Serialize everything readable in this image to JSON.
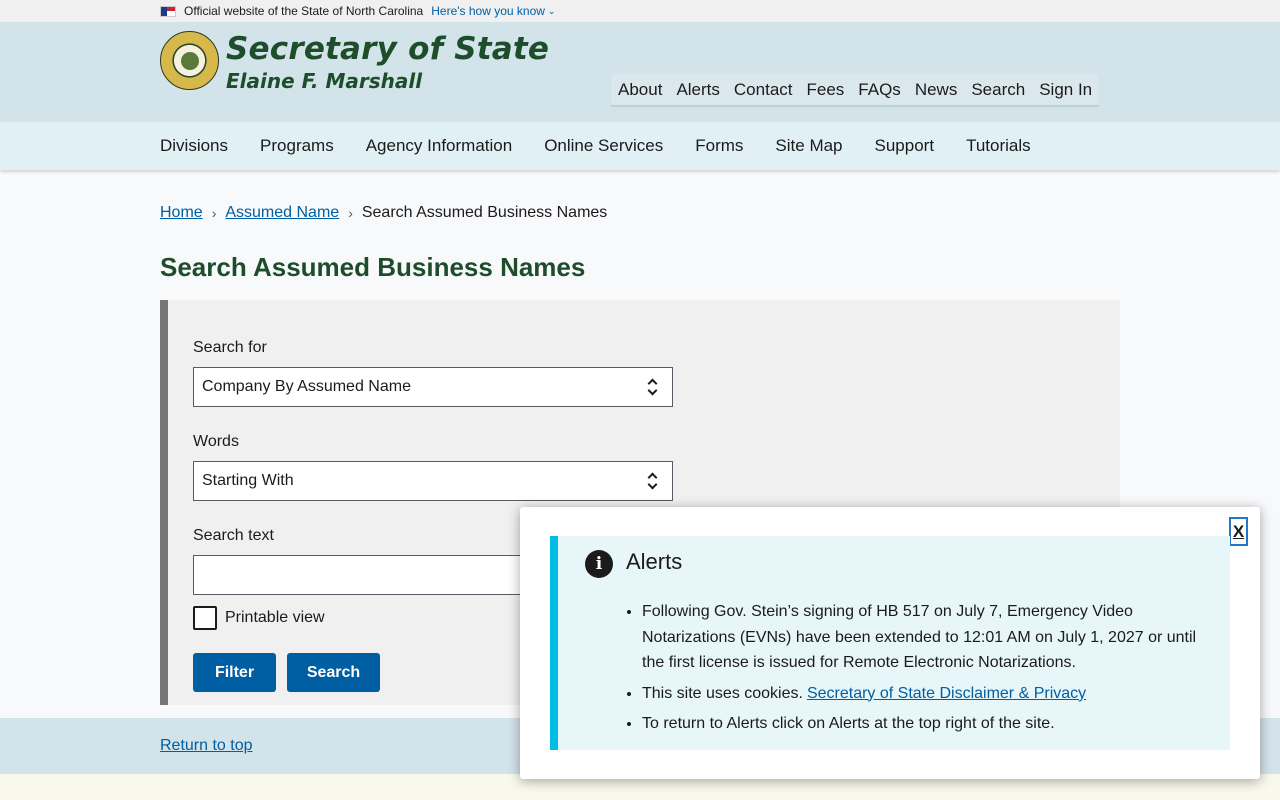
{
  "gov_banner": {
    "text": "Official website of the State of North Carolina",
    "link": "Here's how you know"
  },
  "header": {
    "title": "Secretary of State",
    "subtitle": "Elaine F. Marshall",
    "utility_nav": [
      "About",
      "Alerts",
      "Contact",
      "Fees",
      "FAQs",
      "News",
      "Search",
      "Sign In"
    ]
  },
  "main_nav": [
    "Divisions",
    "Programs",
    "Agency Information",
    "Online Services",
    "Forms",
    "Site Map",
    "Support",
    "Tutorials"
  ],
  "breadcrumb": {
    "home": "Home",
    "parent": "Assumed Name",
    "current": "Search Assumed Business Names"
  },
  "page_title": "Search Assumed Business Names",
  "form": {
    "search_for_label": "Search for",
    "search_for_value": "Company By Assumed Name",
    "words_label": "Words",
    "words_value": "Starting With",
    "search_text_label": "Search text",
    "search_text_value": "",
    "printable_label": "Printable view",
    "filter_button": "Filter",
    "search_button": "Search"
  },
  "footer": {
    "return_to_top": "Return to top"
  },
  "alert": {
    "close_label": "X",
    "icon": "info-icon",
    "heading": "Alerts",
    "item1": "Following Gov. Stein’s signing of HB 517 on July 7, Emergency Video Notarizations (EVNs) have been extended to 12:01 AM on July 1, 2027 or until the first license is issued for Remote Electronic Notarizations.",
    "item2_text": "This site uses cookies.",
    "item2_link": "Secretary of State Disclaimer & Privacy",
    "item3": "To return to Alerts click on Alerts at the top right of the site."
  },
  "colors": {
    "brand_green": "#1e4d2b",
    "link_blue": "#005ea2",
    "button_blue": "#005ea2",
    "alert_accent": "#00bde3"
  }
}
